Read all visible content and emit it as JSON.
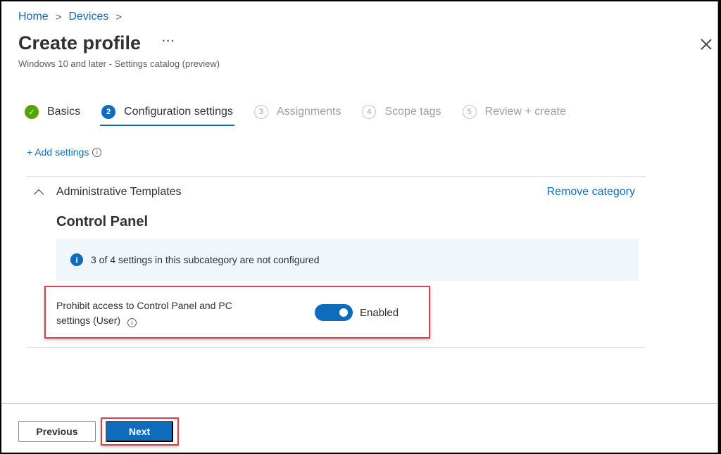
{
  "breadcrumb": [
    {
      "label": "Home"
    },
    {
      "label": "Devices"
    }
  ],
  "header": {
    "title": "Create profile",
    "more_label": "···",
    "subtitle": "Windows 10 and later - Settings catalog (preview)"
  },
  "steps": [
    {
      "number": "✓",
      "label": "Basics",
      "state": "done"
    },
    {
      "number": "2",
      "label": "Configuration settings",
      "state": "active"
    },
    {
      "number": "3",
      "label": "Assignments",
      "state": "todo"
    },
    {
      "number": "4",
      "label": "Scope tags",
      "state": "todo"
    },
    {
      "number": "5",
      "label": "Review + create",
      "state": "todo"
    }
  ],
  "add_settings": {
    "label": "+ Add settings",
    "info_icon": "i"
  },
  "category": {
    "name": "Administrative Templates",
    "remove_label": "Remove category",
    "subcategory": "Control Panel",
    "info_message": "3 of 4 settings in this subcategory are not configured",
    "info_icon": "i",
    "settings": [
      {
        "name": "Prohibit access to Control Panel and PC settings (User)",
        "info_icon": "i",
        "enabled": true,
        "state_label": "Enabled"
      }
    ]
  },
  "footer": {
    "previous_label": "Previous",
    "next_label": "Next"
  },
  "colors": {
    "accent": "#0f6cbd",
    "success": "#57a300",
    "highlight": "#d9414b",
    "info_bg": "#eff6fc"
  }
}
